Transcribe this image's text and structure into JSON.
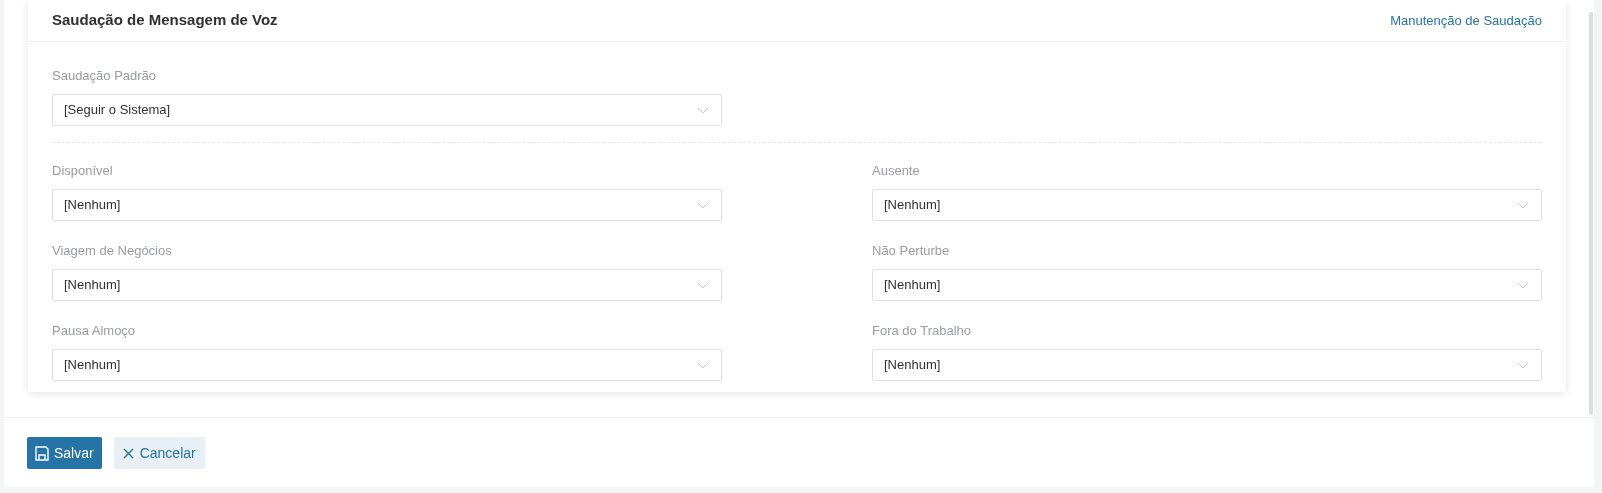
{
  "card": {
    "title": "Saudação de Mensagem de Voz",
    "link": "Manutenção de Saudação"
  },
  "default_greeting": {
    "label": "Saudação Padrão",
    "value": "[Seguir o Sistema]"
  },
  "status_greetings": [
    {
      "label": "Disponível",
      "value": "[Nenhum]"
    },
    {
      "label": "Ausente",
      "value": "[Nenhum]"
    },
    {
      "label": "Viagem de Negócios",
      "value": "[Nenhum]"
    },
    {
      "label": "Não Perturbe",
      "value": "[Nenhum]"
    },
    {
      "label": "Pausa Almoço",
      "value": "[Nenhum]"
    },
    {
      "label": "Fora do Trabalho",
      "value": "[Nenhum]"
    }
  ],
  "buttons": [
    {
      "kind": "save",
      "label": "Salvar"
    },
    {
      "kind": "cancel",
      "label": "Cancelar"
    }
  ]
}
